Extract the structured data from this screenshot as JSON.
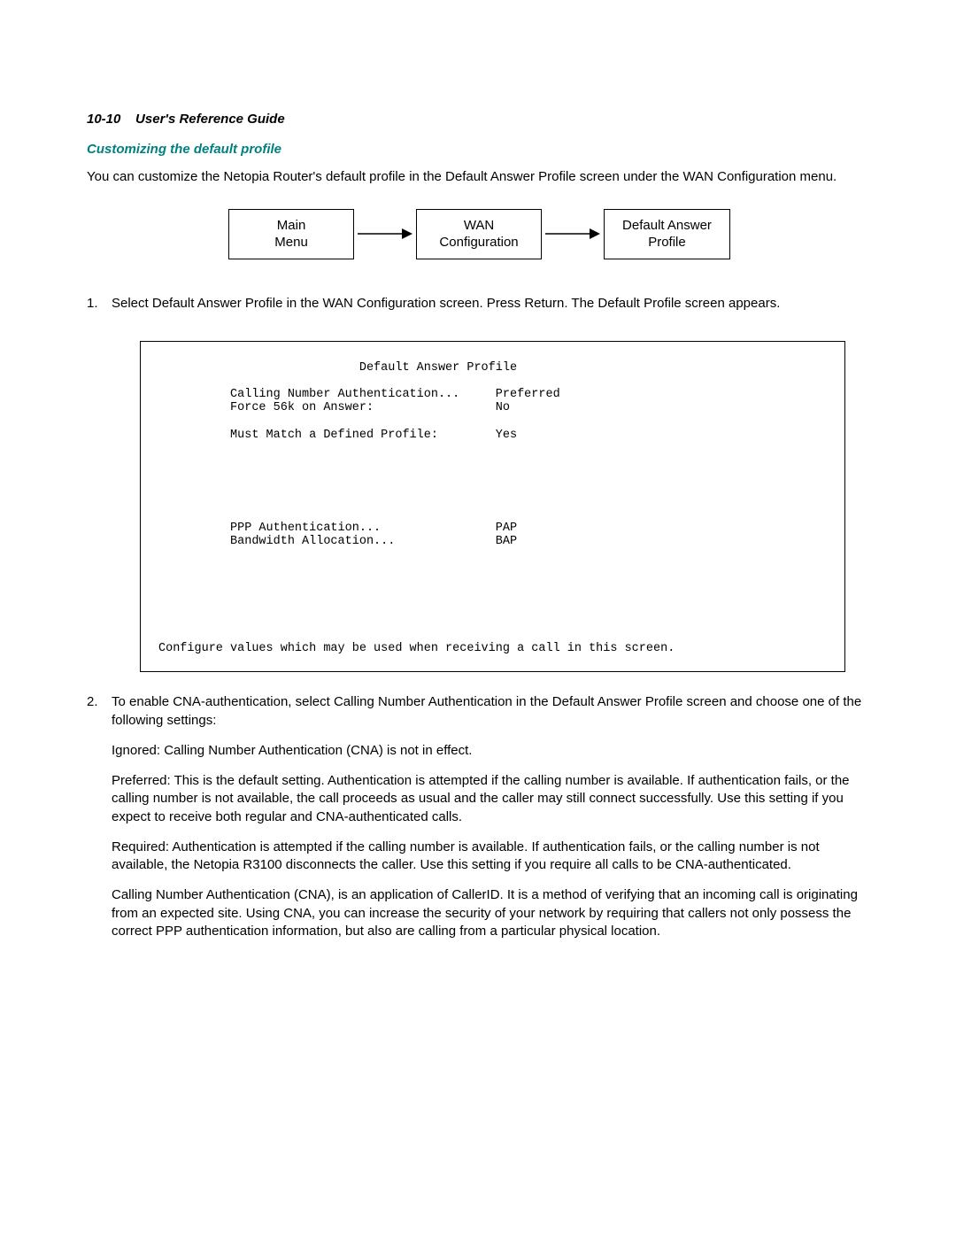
{
  "header": {
    "page_ref": "10-10",
    "guide_title": "User's Reference Guide"
  },
  "section_title": "Customizing the default profile",
  "intro_para": "You can customize the Netopia Router's default profile in the Default Answer Profile screen under the WAN Configuration menu.",
  "flow": {
    "box1_line1": "Main",
    "box1_line2": "Menu",
    "box2_line1": "WAN",
    "box2_line2": "Configuration",
    "box3_line1": "Default Answer",
    "box3_line2": "Profile"
  },
  "steps": [
    {
      "num": "1.",
      "text": "Select Default Answer Profile in the WAN Configuration screen. Press Return. The Default Profile screen appears."
    },
    {
      "num": "2.",
      "text": "To enable CNA-authentication, select Calling Number Authentication in the Default Answer Profile screen and choose one of the following settings:",
      "sub": [
        "Ignored: Calling Number Authentication (CNA) is not in effect.",
        "Preferred: This is the default setting. Authentication is attempted if the calling number is available. If authentication fails, or the calling number is not available, the call proceeds as usual and the caller may still connect successfully. Use this setting if you expect to receive both regular and CNA-authenticated calls.",
        "Required: Authentication is attempted if the calling number is available. If authentication fails, or the calling number is not available, the Netopia R3100 disconnects the caller. Use this setting if you require all calls to be CNA-authenticated.",
        "Calling Number Authentication (CNA), is an application of CallerID. It is a method of verifying that an incoming call is originating from an expected site. Using CNA, you can increase the security of your network by requiring that callers not only possess the correct PPP authentication information, but also are calling from a particular physical location."
      ]
    }
  ],
  "terminal": {
    "title": "Default Answer Profile",
    "rows": [
      {
        "label": "Calling Number Authentication...",
        "value": "Preferred"
      },
      {
        "label": "Force 56k on Answer:",
        "value": "No"
      },
      {
        "label": "",
        "value": ""
      },
      {
        "label": "Must Match a Defined Profile:",
        "value": "Yes"
      },
      {
        "label": "",
        "value": ""
      },
      {
        "label": "",
        "value": ""
      },
      {
        "label": "",
        "value": ""
      },
      {
        "label": "",
        "value": ""
      },
      {
        "label": "",
        "value": ""
      },
      {
        "label": "",
        "value": ""
      },
      {
        "label": "PPP Authentication...",
        "value": "PAP"
      },
      {
        "label": "Bandwidth Allocation...",
        "value": "BAP"
      }
    ],
    "footer": "Configure values which may be used when receiving a call in this screen."
  }
}
